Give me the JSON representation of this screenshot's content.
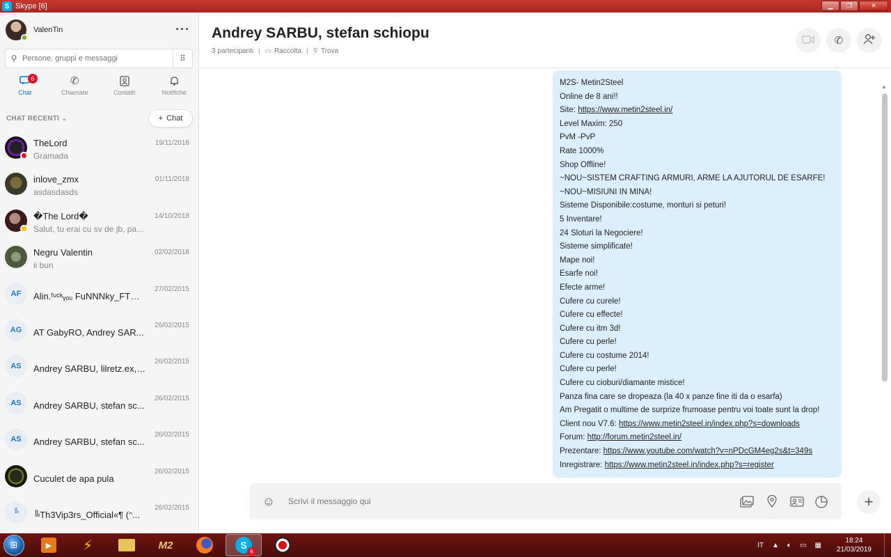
{
  "window": {
    "title": "Skype [6]",
    "app_icon": "S"
  },
  "profile": {
    "name": "ValenTin",
    "status_color": "#6bb700"
  },
  "search": {
    "placeholder": "Persone, gruppi e messaggi"
  },
  "nav": [
    {
      "label": "Chat",
      "icon": "chat-icon",
      "badge": "6",
      "active": true
    },
    {
      "label": "Chiamate",
      "icon": "phone-icon"
    },
    {
      "label": "Contatti",
      "icon": "contacts-icon"
    },
    {
      "label": "Notifiche",
      "icon": "bell-icon"
    }
  ],
  "recent": {
    "header": "CHAT RECENTI",
    "new_chat_label": "Chat"
  },
  "chats": [
    {
      "name": "TheLord",
      "preview": "Gramada",
      "date": "19/11/2018",
      "avatar": "image",
      "status": "#e81123"
    },
    {
      "name": "inlove_zmx",
      "preview": "asdasdasds",
      "date": "01/11/2018",
      "avatar": "image"
    },
    {
      "name": "�The Lord�",
      "preview": "Salut, tu erai cu sv de jb, pa...",
      "date": "14/10/2018",
      "avatar": "image",
      "status": "#f8c300"
    },
    {
      "name": "Negru Valentin",
      "preview": "ii bun",
      "date": "02/02/2018",
      "avatar": "image"
    },
    {
      "name": "Alin.ᶠᶸᶜᵏᵧₒᵤ FuNNNky_FTW,...",
      "preview": "",
      "date": "27/02/2015",
      "initials": "AF"
    },
    {
      "name": "AT GabyRO, Andrey SAR...",
      "preview": "",
      "date": "26/02/2015",
      "initials": "AG"
    },
    {
      "name": "Andrey SARBU, lilretz.ex, ...",
      "preview": "",
      "date": "26/02/2015",
      "initials": "AS"
    },
    {
      "name": "Andrey SARBU, stefan sc...",
      "preview": "",
      "date": "26/02/2015",
      "initials": "AS"
    },
    {
      "name": "Andrey SARBU, stefan sc...",
      "preview": "",
      "date": "26/02/2015",
      "initials": "AS"
    },
    {
      "name": "Cuculet de apa pula",
      "preview": "",
      "date": "26/02/2015",
      "avatar": "image"
    },
    {
      "name": "╚Th3Vip3rs_Official«¶ (ᵔ...",
      "preview": "",
      "date": "26/02/2015",
      "initials": "╚"
    }
  ],
  "conversation": {
    "title": "Andrey SARBU, stefan schiopu",
    "participants": "3 partecipanti",
    "gallery": "Raccolta",
    "find": "Trova"
  },
  "message": {
    "lines": [
      "M2S- Metin2Steel",
      "Online de 8 ani!!",
      {
        "prefix": "Site: ",
        "link": "https://www.metin2steel.in/"
      },
      "Level Maxim: 250",
      "PvM -PvP",
      "Rate 1000%",
      "Shop Offline!",
      "~NOU~SISTEM CRAFTING ARMURI, ARME LA AJUTORUL DE ESARFE!",
      "~NOU~MISIUNI IN MINA!",
      "Sisteme Disponibile:costume, monturi si peturi!",
      "5 Inventare!",
      "24 Sloturi la Negociere!",
      "Sisteme simplificate!",
      "Mape noi!",
      "Esarfe noi!",
      "Efecte arme!",
      "Cufere cu curele!",
      "Cufere cu effecte!",
      "Cufere cu itm 3d!",
      "Cufere cu perle!",
      "Cufere cu costume 2014!",
      "Cufere cu perle!",
      "Cufere cu cioburi/diamante mistice!",
      "Panza fina care se dropeaza (la 40 x panze fine iti da o esarfa)",
      "Am Pregatit o multime de surprize frumoase pentru voi toate sunt la drop!",
      {
        "prefix": "Client nou V7.6: ",
        "link": "https://www.metin2steel.in/index.php?s=downloads"
      },
      {
        "prefix": "Forum: ",
        "link": "http://forum.metin2steel.in/"
      },
      {
        "prefix": "Prezentare: ",
        "link": "https://www.youtube.com/watch?v=nPDcGM4eg2s&t=349s"
      },
      {
        "prefix": "Inregistrare: ",
        "link": "https://www.metin2steel.in/index.php?s=register"
      }
    ],
    "bubble_color": "#dbeffd"
  },
  "composer": {
    "placeholder": "Scrivi il messaggio qui"
  },
  "taskbar": {
    "apps": [
      {
        "name": "media-player",
        "active": false
      },
      {
        "name": "winamp",
        "active": false
      },
      {
        "name": "file-explorer",
        "active": false
      },
      {
        "name": "metin2",
        "active": false
      },
      {
        "name": "firefox",
        "active": false
      },
      {
        "name": "skype",
        "active": true,
        "badge": "6"
      },
      {
        "name": "recorder",
        "active": false
      }
    ],
    "language": "IT",
    "time": "18:24",
    "date": "21/03/2019"
  },
  "colors": {
    "accent": "#0078d4",
    "badge": "#e81123",
    "taskbar": "#6e1410"
  }
}
